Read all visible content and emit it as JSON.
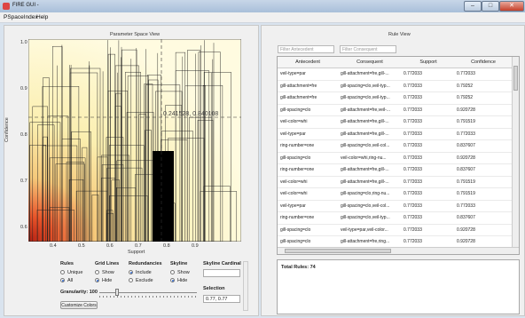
{
  "window": {
    "title": "FIRE GUI -",
    "minimize": "–",
    "maximize": "□",
    "close": "✕"
  },
  "menu": [
    "PSpaceIndex",
    "Help"
  ],
  "left": {
    "title": "Parameter Space View",
    "tooltip": "0.241528, 0.840108",
    "xlabel": "Support",
    "ylabel": "Confidence",
    "xticks": [
      "0.4",
      "0.5",
      "0.6",
      "0.7",
      "0.8",
      "0.9"
    ],
    "yticks": [
      "1.0",
      "0.9",
      "0.8",
      "0.7",
      "0.6"
    ]
  },
  "controls": {
    "rules": {
      "title": "Rules",
      "opt1": "Unique",
      "opt2": "All",
      "selected": "All"
    },
    "grid": {
      "title": "Grid Lines",
      "opt1": "Show",
      "opt2": "Hide",
      "selected": "Hide"
    },
    "redund": {
      "title": "Redundancies",
      "opt1": "Include",
      "opt2": "Exclude",
      "selected": "Include"
    },
    "skyline": {
      "title": "Skyline",
      "opt1": "Show",
      "opt2": "Hide",
      "selected": "Hide"
    },
    "card": {
      "title": "Skyline Cardinal"
    },
    "granularity": {
      "label": "Granularity: 100"
    },
    "customize": "Customize Colors",
    "selection": {
      "title": "Selection",
      "value": "0.77, 0.77"
    }
  },
  "right": {
    "title": "Rule View",
    "filter_antecedent": "Filter Antecedent",
    "filter_consequent": "Filter Consequent",
    "headers": [
      "Antecedent",
      "Consequent",
      "Support",
      "Confidence"
    ],
    "rows": [
      [
        "veil-type=par",
        "gill-attachment=fre,gill-...",
        "0.772033",
        "0.772033"
      ],
      [
        "gill-attachment=fre",
        "gill-spacing=clo,veil-typ...",
        "0.772033",
        "0.79252"
      ],
      [
        "gill-attachment=fre",
        "gill-spacing=clo,veil-typ...",
        "0.772033",
        "0.79252"
      ],
      [
        "gill-spacing=clo",
        "gill-attachment=fre,veil-...",
        "0.772033",
        "0.920728"
      ],
      [
        "veil-color=whi",
        "gill-attachment=fre,gill-...",
        "0.772033",
        "0.791519"
      ],
      [
        "veil-type=par",
        "gill-attachment=fre,gill-...",
        "0.772033",
        "0.772033"
      ],
      [
        "ring-number=one",
        "gill-spacing=clo,veil-col...",
        "0.772033",
        "0.837607"
      ],
      [
        "gill-spacing=clo",
        "veil-color=whi,ring-nu...",
        "0.772033",
        "0.920728"
      ],
      [
        "ring-number=one",
        "gill-attachment=fre,gill-...",
        "0.772033",
        "0.837607"
      ],
      [
        "veil-color=whi",
        "gill-attachment=fre,gill-...",
        "0.772033",
        "0.791519"
      ],
      [
        "veil-color=whi",
        "gill-spacing=clo,ring-nu...",
        "0.772033",
        "0.791519"
      ],
      [
        "veil-type=par",
        "gill-spacing=clo,veil-col...",
        "0.772033",
        "0.772033"
      ],
      [
        "ring-number=one",
        "gill-spacing=clo,veil-typ...",
        "0.772033",
        "0.837607"
      ],
      [
        "gill-spacing=clo",
        "veil-type=par,veil-color...",
        "0.772033",
        "0.920728"
      ],
      [
        "gill-spacing=clo",
        "gill-attachment=fre,ring...",
        "0.772033",
        "0.920728"
      ]
    ],
    "total": "Total Rules: 74"
  }
}
